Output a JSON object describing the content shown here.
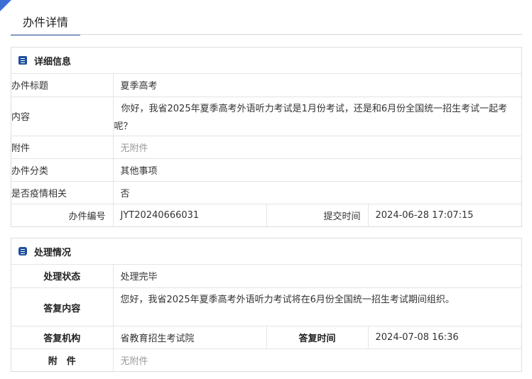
{
  "page": {
    "tab_title": "办件详情"
  },
  "detail": {
    "title": "详细信息",
    "rows": {
      "subject_label": "办件标题",
      "subject_value": "夏季高考",
      "content_label": "内容",
      "content_line1": "你好，我省2025年夏季高考外语听力考试是1月份考试，还是和6月份全国统一招生考试一起考",
      "content_line2": "呢？",
      "attach_label": "附件",
      "attach_value": "无附件",
      "category_label": "办件分类",
      "category_value": "其他事项",
      "epidemic_label": "是否疫情相关",
      "epidemic_value": "否",
      "number_label": "办件编号",
      "number_value": "JYT20240666031",
      "submit_time_label": "提交时间",
      "submit_time_value": "2024-06-28 17:07:15"
    }
  },
  "handling": {
    "title": "处理情况",
    "rows": {
      "status_label": "处理状态",
      "status_value": "处理完毕",
      "reply_label": "答复内容",
      "reply_value": "您好，我省2025年夏季高考外语听力考试将在6月份全国统一招生考试期间组织。",
      "org_label": "答复机构",
      "org_value": "省教育招生考试院",
      "reply_time_label": "答复时间",
      "reply_time_value": "2024-07-08 16:36",
      "attach_label": "附　件",
      "attach_value": "无附件"
    }
  },
  "colors": {
    "accent": "#3b6fd4",
    "icon": "#1f4f9c",
    "muted": "#999999"
  }
}
